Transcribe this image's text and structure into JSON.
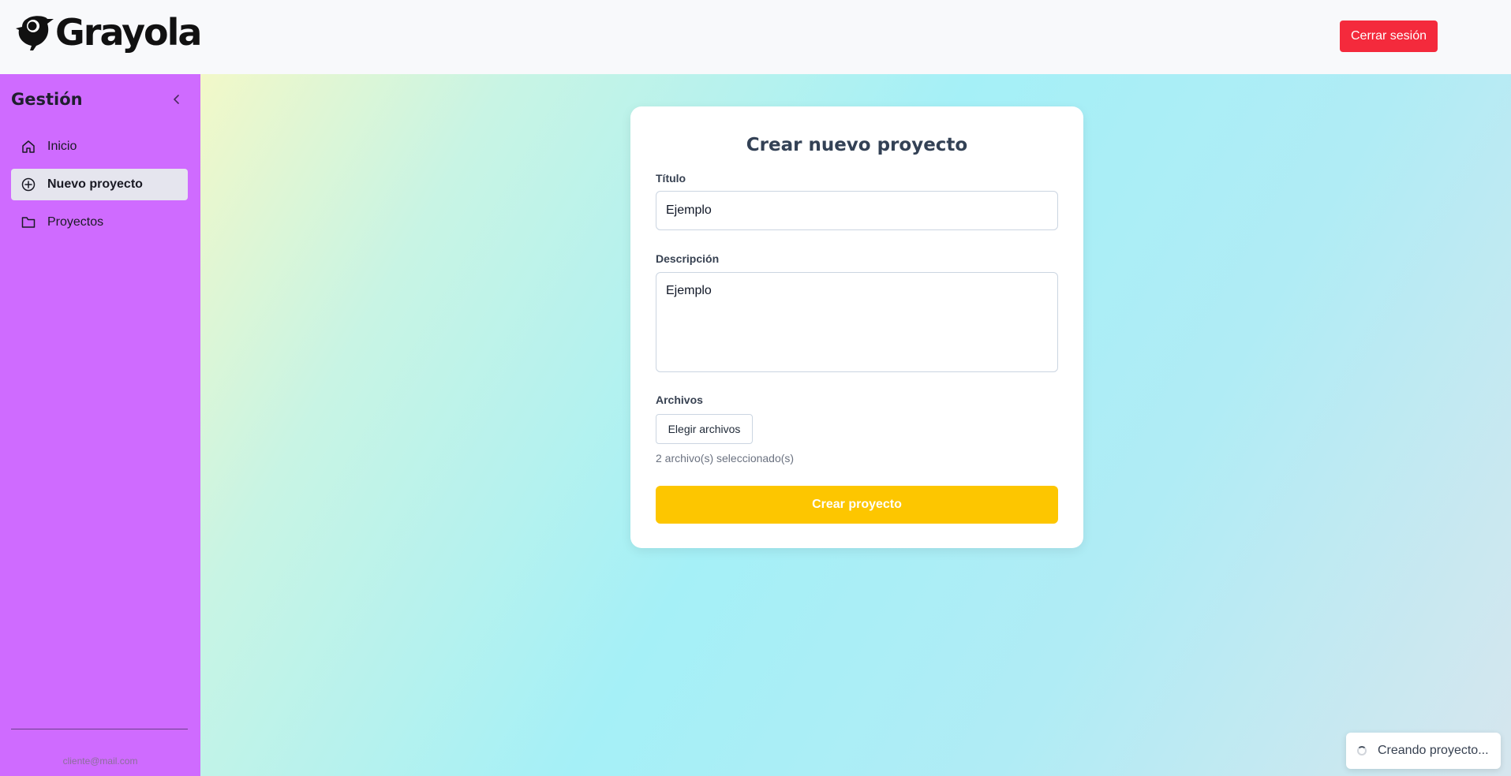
{
  "header": {
    "brand": "Grayola",
    "logout_label": "Cerrar sesión",
    "logout_color": "#f42a3c"
  },
  "sidebar": {
    "title": "Gestión",
    "collapse_icon": "chevron-left-icon",
    "background": "#cf6bff",
    "items": [
      {
        "label": "Inicio",
        "icon": "home-icon",
        "active": false
      },
      {
        "label": "Nuevo proyecto",
        "icon": "plus-circle-icon",
        "active": true
      },
      {
        "label": "Proyectos",
        "icon": "folder-icon",
        "active": false
      }
    ],
    "user_email": "cliente@mail.com"
  },
  "form": {
    "title": "Crear nuevo proyecto",
    "titulo_label": "Título",
    "titulo_value": "Ejemplo",
    "descripcion_label": "Descripción",
    "descripcion_value": "Ejemplo",
    "archivos_label": "Archivos",
    "choose_files_label": "Elegir archivos",
    "files_status": "2 archivo(s) seleccionado(s)",
    "submit_label": "Crear proyecto",
    "submit_color": "#fdc600"
  },
  "toast": {
    "message": "Creando proyecto...",
    "icon": "spinner-icon"
  }
}
